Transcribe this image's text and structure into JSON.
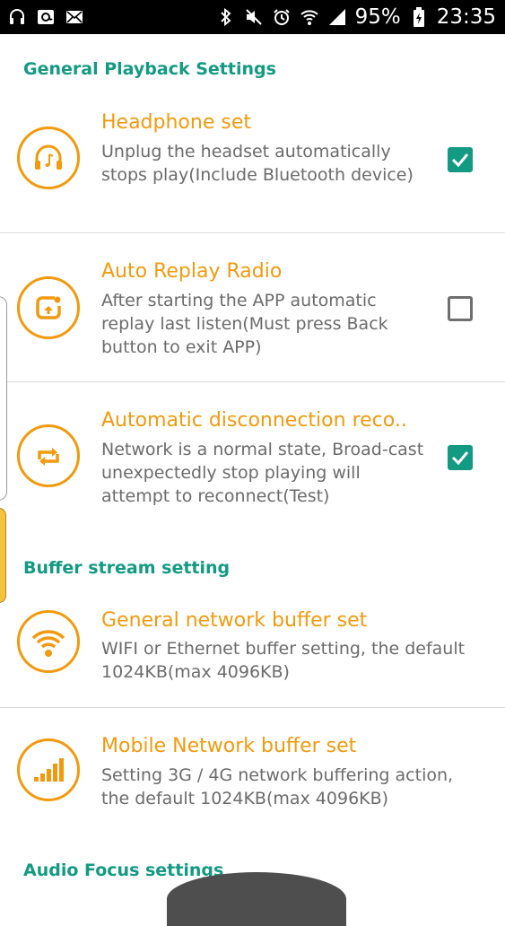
{
  "statusbar": {
    "left_icons": [
      "headphones-icon",
      "email-at-icon",
      "mail-envelope-icon"
    ],
    "right_icons": [
      "bluetooth-icon",
      "mute-icon",
      "alarm-icon",
      "wifi-icon",
      "signal-icon",
      "battery-charging-icon"
    ],
    "battery": "95%",
    "time": "23:35"
  },
  "colors": {
    "accent_orange": "#f29a0e",
    "accent_teal": "#139a82",
    "desc_gray": "#6b6b6b"
  },
  "sections": {
    "general": "General Playback Settings",
    "buffer": "Buffer stream setting",
    "audio_focus": "Audio Focus settings"
  },
  "rows": [
    {
      "icon": "headphone-note-icon",
      "title": "Headphone set",
      "desc": "Unplug the headset automatically stops play(Include Bluetooth device)",
      "checked": true
    },
    {
      "icon": "replay-icon",
      "title": "Auto Replay Radio",
      "desc": "After starting the APP automatic replay last listen(Must press Back button to exit APP)",
      "checked": false
    },
    {
      "icon": "reconnect-arrows-icon",
      "title": "Automatic disconnection reco..",
      "desc": "Network is a normal state, Broad-cast unexpectedly stop playing will attempt to reconnect(Test)",
      "checked": true
    },
    {
      "icon": "wifi-icon",
      "title": "General network buffer set",
      "desc": "WIFI or Ethernet buffer setting, the default 1024KB(max 4096KB)"
    },
    {
      "icon": "signal-bars-icon",
      "title": "Mobile Network buffer set",
      "desc": "Setting 3G / 4G network buffering action, the default 1024KB(max 4096KB)"
    }
  ]
}
